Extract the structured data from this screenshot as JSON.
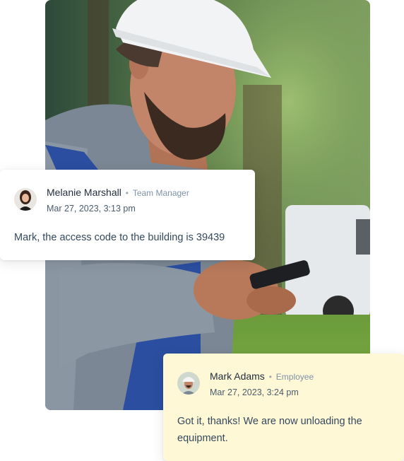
{
  "photo": {
    "alt_subject": "worker-with-hard-hat-using-phone"
  },
  "messages": [
    {
      "sender": "Melanie Marshall",
      "separator": "•",
      "role": "Team Manager",
      "timestamp": "Mar 27, 2023, 3:13 pm",
      "text": "Mark, the access code to the building is 39439",
      "card_color": "#ffffff"
    },
    {
      "sender": "Mark Adams",
      "separator": "•",
      "role": "Employee",
      "timestamp": "Mar 27, 2023, 3:24 pm",
      "text": "Got it, thanks! We are now unloading the equipment.",
      "card_color": "#fff8d6"
    }
  ],
  "colors": {
    "name": "#1f2d3d",
    "role": "#7f93a8",
    "message": "#34495e",
    "reply_card": "#fff8d6"
  }
}
